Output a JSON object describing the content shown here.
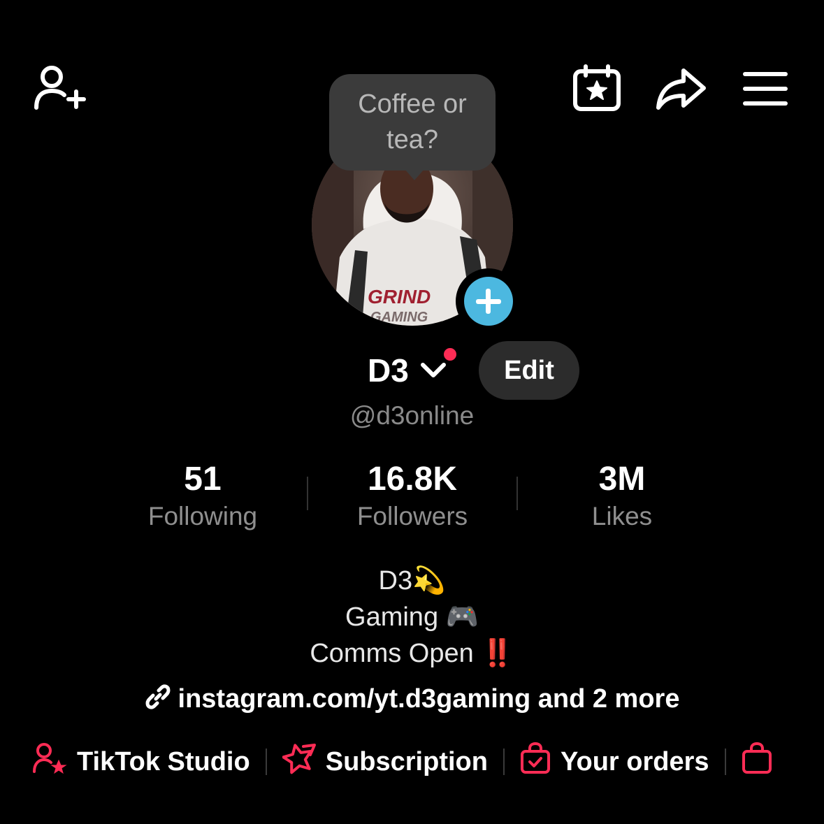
{
  "header": {
    "add_friend_icon": "person-add-icon",
    "calendar_icon": "calendar-star-icon",
    "share_icon": "share-arrow-icon",
    "menu_icon": "hamburger-menu-icon"
  },
  "tooltip": {
    "line1": "Coffee or",
    "line2": "tea?"
  },
  "profile": {
    "display_name": "D3",
    "username": "@d3online",
    "edit_label": "Edit",
    "avatar_add_icon": "plus-icon"
  },
  "stats": [
    {
      "value": "51",
      "label": "Following"
    },
    {
      "value": "16.8K",
      "label": "Followers"
    },
    {
      "value": "3M",
      "label": "Likes"
    }
  ],
  "bio": {
    "line1": "D3",
    "line1_emoji": "💫",
    "line2": "Gaming",
    "line2_emoji": "🎮",
    "line3": "Comms Open",
    "line3_emoji": "‼️"
  },
  "link": {
    "text": "instagram.com/yt.d3gaming and 2 more",
    "icon": "link-icon"
  },
  "shortcuts": [
    {
      "label": "TikTok Studio",
      "icon": "person-star-icon"
    },
    {
      "label": "Subscription",
      "icon": "star-badge-icon"
    },
    {
      "label": "Your orders",
      "icon": "shopping-bag-check-icon"
    }
  ],
  "colors": {
    "accent": "#fe2c55",
    "add_badge": "#4cb8e0",
    "background": "#000000"
  }
}
